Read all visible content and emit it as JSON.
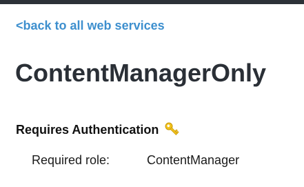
{
  "nav": {
    "back_link_label": "<back to all web services"
  },
  "page": {
    "title": "ContentManagerOnly"
  },
  "auth": {
    "heading": "Requires Authentication",
    "icon": "key-icon",
    "icon_color": "#f2c21b",
    "required_role_label": "Required role:",
    "required_role_value": "ContentManager"
  },
  "colors": {
    "link": "#3d8fce",
    "title": "#2a2f36",
    "top_bar": "#2c3138"
  }
}
